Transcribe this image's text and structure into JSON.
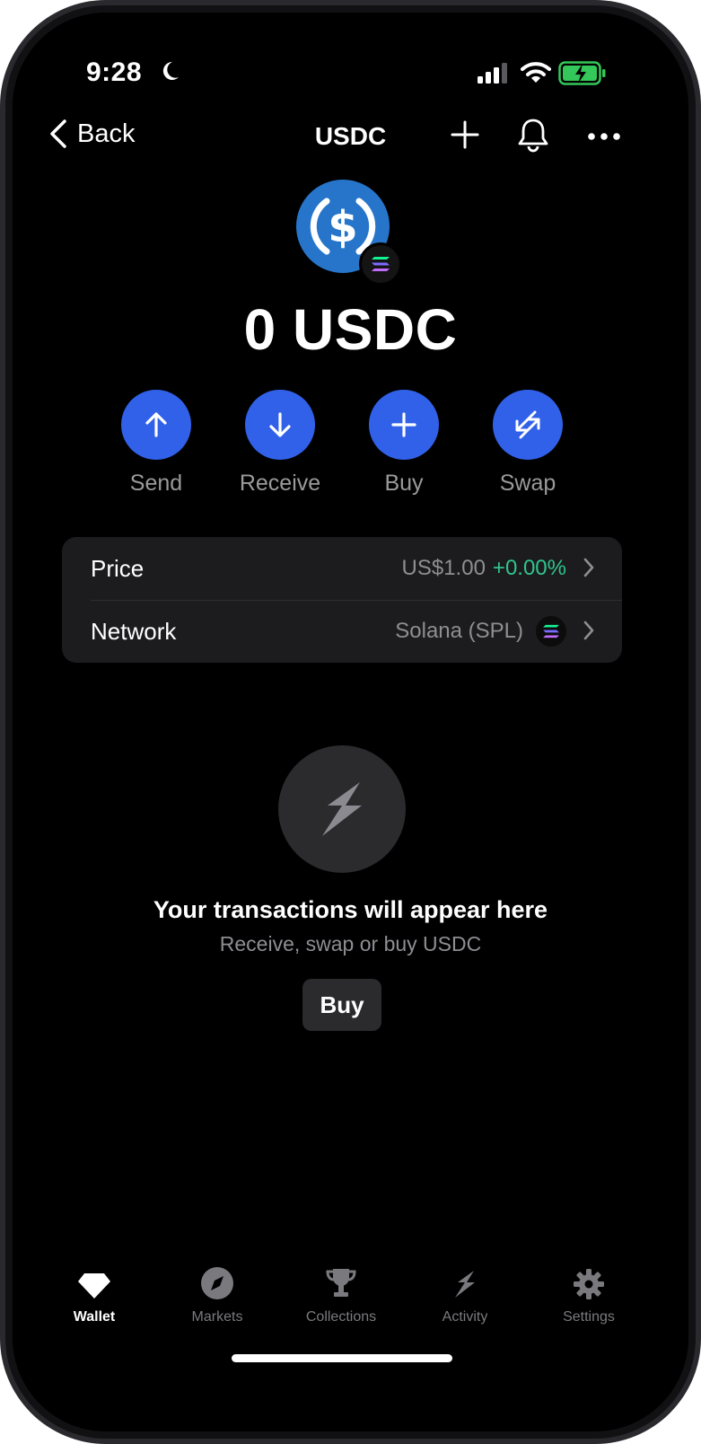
{
  "status": {
    "time": "9:28"
  },
  "nav": {
    "back_label": "Back",
    "title": "USDC"
  },
  "token": {
    "balance": "0 USDC",
    "brand_color": "#2775CA"
  },
  "actions": [
    {
      "label": "Send",
      "icon": "arrow-up-icon"
    },
    {
      "label": "Receive",
      "icon": "arrow-down-icon"
    },
    {
      "label": "Buy",
      "icon": "plus-icon"
    },
    {
      "label": "Swap",
      "icon": "swap-icon"
    }
  ],
  "details": {
    "price_label": "Price",
    "price_value": "US$1.00",
    "price_change": "+0.00%",
    "network_label": "Network",
    "network_value": "Solana (SPL)"
  },
  "empty": {
    "title": "Your transactions will appear here",
    "subtitle": "Receive, swap or buy USDC",
    "button": "Buy"
  },
  "tabs": [
    {
      "label": "Wallet",
      "icon": "diamond-icon",
      "active": true
    },
    {
      "label": "Markets",
      "icon": "compass-icon",
      "active": false
    },
    {
      "label": "Collections",
      "icon": "trophy-icon",
      "active": false
    },
    {
      "label": "Activity",
      "icon": "lightning-icon",
      "active": false
    },
    {
      "label": "Settings",
      "icon": "gear-icon",
      "active": false
    }
  ],
  "colors": {
    "accent": "#3161E8",
    "positive": "#30C48D",
    "battery": "#34C759"
  }
}
